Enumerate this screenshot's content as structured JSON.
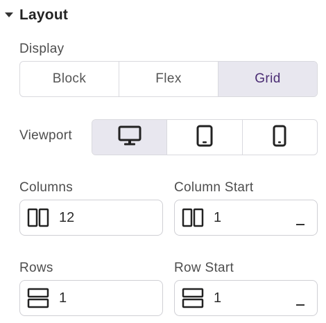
{
  "section": {
    "title": "Layout",
    "expanded": true,
    "caret_icon": "caret-down-icon"
  },
  "display": {
    "label": "Display",
    "options": [
      "Block",
      "Flex",
      "Grid"
    ],
    "selected": "Grid"
  },
  "viewport": {
    "label": "Viewport",
    "options": [
      {
        "icon": "desktop-icon",
        "selected": true
      },
      {
        "icon": "tablet-icon",
        "selected": false
      },
      {
        "icon": "mobile-icon",
        "selected": false
      }
    ]
  },
  "columns": {
    "label": "Columns",
    "value": "12",
    "icon": "columns-icon"
  },
  "column_start": {
    "label": "Column Start",
    "value": "1",
    "icon": "columns-icon",
    "unit_icon": "unit-dash-icon"
  },
  "rows": {
    "label": "Rows",
    "value": "1",
    "icon": "rows-icon"
  },
  "row_start": {
    "label": "Row Start",
    "value": "1",
    "icon": "rows-icon",
    "unit_icon": "unit-dash-icon"
  },
  "colors": {
    "accent_text": "#4a2c73",
    "active_bg": "#e8e7ef",
    "border": "#d9d9de"
  }
}
